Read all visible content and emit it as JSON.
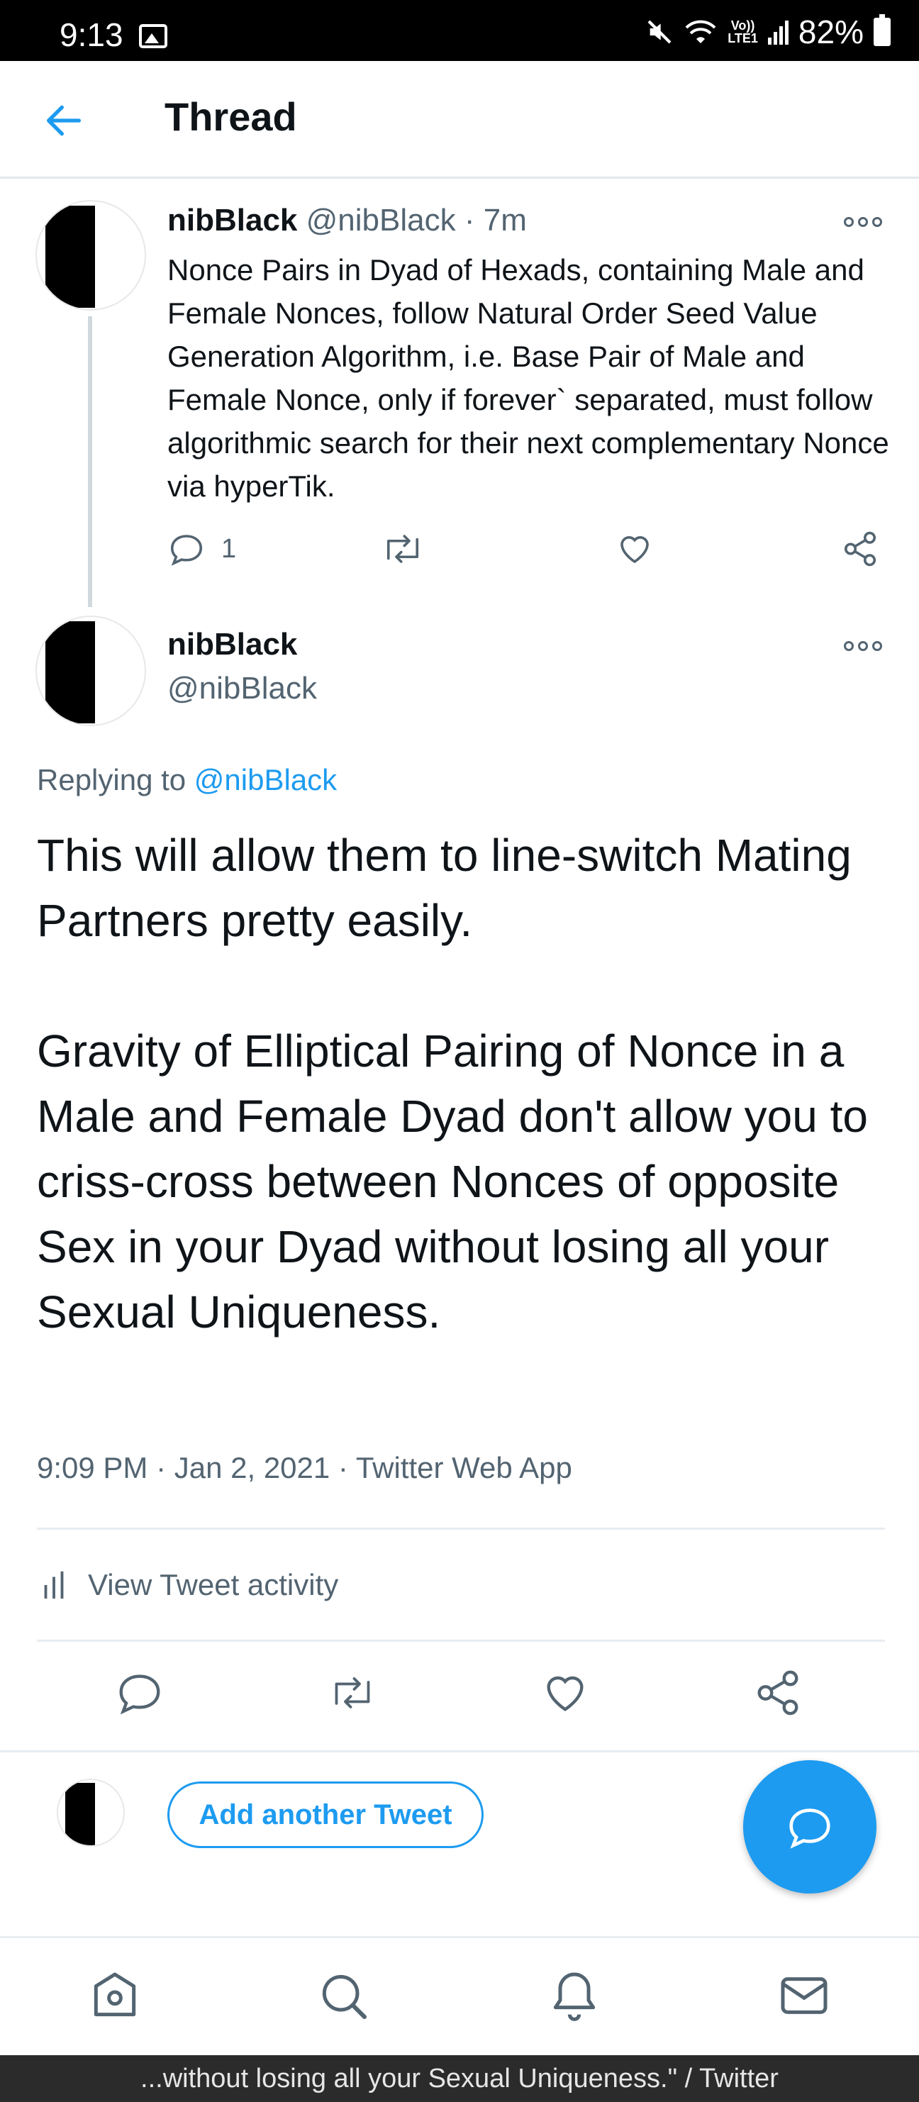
{
  "status_bar": {
    "time": "9:13",
    "network_type": "LTE1",
    "volte": "Vo))",
    "battery": "82%"
  },
  "header": {
    "title": "Thread",
    "back_icon": "arrow-left-icon"
  },
  "tweet1": {
    "name": "nibBlack",
    "handle": "@nibBlack",
    "time": "· 7m",
    "text": "Nonce Pairs in Dyad of Hexads, containing Male and Female Nonces, follow Natural Order Seed Value Generation Algorithm, i.e. Base Pair of Male and Female Nonce, only if forever` separated, must follow algorithmic search for their next complementary Nonce via hyperTik.",
    "reply_count": "1",
    "actions": [
      "reply-icon",
      "retweet-icon",
      "like-icon",
      "share-icon"
    ]
  },
  "tweet2": {
    "name": "nibBlack",
    "handle": "@nibBlack",
    "replying_prefix": "Replying to ",
    "replying_mention": "@nibBlack",
    "text": "This will allow them to line-switch Mating Partners pretty easily.\n\nGravity of Elliptical Pairing of Nonce in a Male and Female Dyad don't allow you to criss-cross between Nonces of opposite Sex in your Dyad without losing all your Sexual Uniqueness.",
    "meta": "9:09 PM · Jan 2, 2021 · Twitter Web App",
    "activity_label": "View Tweet activity"
  },
  "composer": {
    "add_button_label": "Add another Tweet"
  },
  "bottom_nav": [
    "home-icon",
    "search-icon",
    "notifications-icon",
    "messages-icon"
  ],
  "caption": "...without losing all your Sexual Uniqueness.\" / Twitter",
  "colors": {
    "accent": "#1d9bf0",
    "secondary_text": "#536471",
    "primary_text": "#0f1419"
  }
}
